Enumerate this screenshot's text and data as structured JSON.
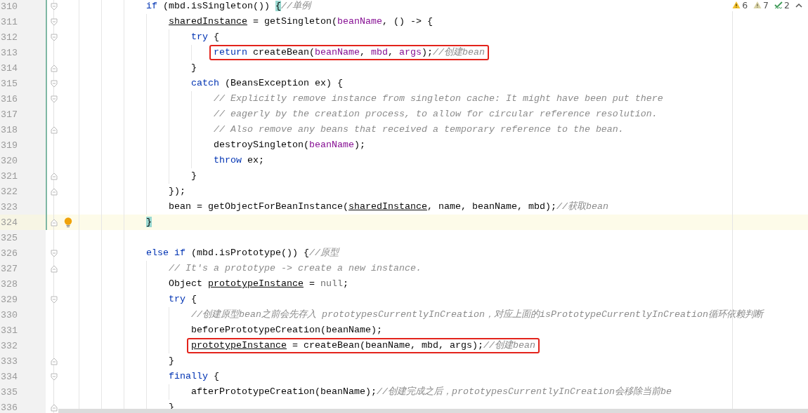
{
  "inspections": [
    {
      "kind": "warning",
      "count": "6"
    },
    {
      "kind": "weak-warning",
      "count": "7"
    },
    {
      "kind": "typo",
      "count": "2"
    }
  ],
  "lines": [
    {
      "number": "310",
      "fold_open": true,
      "changed": true,
      "tokens": [
        {
          "text": "if",
          "kind": "keyword"
        },
        {
          "text": " (mbd.isSingleton()) ",
          "kind": "plain"
        },
        {
          "text": "{",
          "kind": "brace-match"
        },
        {
          "text": "//单例",
          "kind": "comment"
        }
      ],
      "children": [
        {
          "number": "311",
          "fold_open": true,
          "changed": true,
          "tokens": [
            {
              "text": "sharedInstance",
              "kind": "field"
            },
            {
              "text": " = getSingleton(",
              "kind": "plain"
            },
            {
              "text": "beanName",
              "kind": "param"
            },
            {
              "text": ", () -> {",
              "kind": "plain"
            }
          ],
          "children": [
            {
              "number": "312",
              "fold_open": true,
              "changed": true,
              "tokens": [
                {
                  "text": "try",
                  "kind": "keyword"
                },
                {
                  "text": " {",
                  "kind": "plain"
                }
              ],
              "children": [
                {
                  "number": "313",
                  "changed": true,
                  "boxed": true,
                  "tokens": [
                    {
                      "text": "return",
                      "kind": "keyword"
                    },
                    {
                      "text": " createBean(",
                      "kind": "plain"
                    },
                    {
                      "text": "beanName",
                      "kind": "param"
                    },
                    {
                      "text": ", ",
                      "kind": "plain"
                    },
                    {
                      "text": "mbd",
                      "kind": "param"
                    },
                    {
                      "text": ", ",
                      "kind": "plain"
                    },
                    {
                      "text": "args",
                      "kind": "param"
                    },
                    {
                      "text": ");",
                      "kind": "plain"
                    },
                    {
                      "text": "//创建bean",
                      "kind": "comment"
                    }
                  ]
                }
              ]
            },
            {
              "number": "314",
              "fold_close": true,
              "changed": true,
              "tokens": [
                {
                  "text": "}",
                  "kind": "plain"
                }
              ]
            },
            {
              "number": "315",
              "fold_open": true,
              "changed": true,
              "tokens": [
                {
                  "text": "catch",
                  "kind": "keyword"
                },
                {
                  "text": " (BeansException ex) {",
                  "kind": "plain"
                }
              ],
              "children": [
                {
                  "number": "316",
                  "fold_open": true,
                  "changed": true,
                  "tokens": [
                    {
                      "text": "// Explicitly remove instance from singleton cache: It might have been put there",
                      "kind": "comment"
                    }
                  ]
                },
                {
                  "number": "317",
                  "changed": true,
                  "tokens": [
                    {
                      "text": "// eagerly by the creation process, to allow for circular reference resolution.",
                      "kind": "comment"
                    }
                  ]
                },
                {
                  "number": "318",
                  "fold_close": true,
                  "changed": true,
                  "tokens": [
                    {
                      "text": "// Also remove any beans that received a temporary reference to the bean.",
                      "kind": "comment"
                    }
                  ]
                },
                {
                  "number": "319",
                  "changed": true,
                  "tokens": [
                    {
                      "text": "destroySingleton(",
                      "kind": "plain"
                    },
                    {
                      "text": "beanName",
                      "kind": "param"
                    },
                    {
                      "text": ");",
                      "kind": "plain"
                    }
                  ]
                },
                {
                  "number": "320",
                  "changed": true,
                  "tokens": [
                    {
                      "text": "throw",
                      "kind": "keyword"
                    },
                    {
                      "text": " ex;",
                      "kind": "plain"
                    }
                  ]
                }
              ]
            },
            {
              "number": "321",
              "fold_close": true,
              "changed": true,
              "tokens": [
                {
                  "text": "}",
                  "kind": "plain"
                }
              ]
            }
          ]
        },
        {
          "number": "322",
          "fold_close": true,
          "changed": true,
          "tokens": [
            {
              "text": "});",
              "kind": "plain"
            }
          ]
        },
        {
          "number": "323",
          "changed": true,
          "tokens": [
            {
              "text": "bean = getObjectForBeanInstance(",
              "kind": "plain"
            },
            {
              "text": "sharedInstance",
              "kind": "field"
            },
            {
              "text": ", name, beanName, mbd);",
              "kind": "plain"
            },
            {
              "text": "//获取bean",
              "kind": "comment"
            }
          ]
        }
      ]
    },
    {
      "number": "324",
      "fold_close": true,
      "changed": true,
      "current": true,
      "bulb": true,
      "tokens": [
        {
          "text": "}",
          "kind": "brace-match"
        }
      ]
    },
    {
      "number": "325"
    },
    {
      "number": "326",
      "fold_open": true,
      "tokens": [
        {
          "text": "else if",
          "kind": "keyword"
        },
        {
          "text": " (mbd.isPrototype()) {",
          "kind": "plain"
        },
        {
          "text": "//原型",
          "kind": "comment"
        }
      ],
      "children": [
        {
          "number": "327",
          "fold_close": true,
          "tokens": [
            {
              "text": "// It's a prototype -> create a new instance.",
              "kind": "comment"
            }
          ]
        },
        {
          "number": "328",
          "tokens": [
            {
              "text": "Object ",
              "kind": "plain"
            },
            {
              "text": "prototypeInstance",
              "kind": "field"
            },
            {
              "text": " = ",
              "kind": "plain"
            },
            {
              "text": "null",
              "kind": "literal"
            },
            {
              "text": ";",
              "kind": "plain"
            }
          ]
        },
        {
          "number": "329",
          "fold_open": true,
          "tokens": [
            {
              "text": "try",
              "kind": "keyword"
            },
            {
              "text": " {",
              "kind": "plain"
            }
          ],
          "children": [
            {
              "number": "330",
              "tokens": [
                {
                  "text": "//创建原型bean之前会先存入 prototypesCurrentlyInCreation，对应上面的isPrototypeCurrentlyInCreation循环依赖判断",
                  "kind": "comment"
                }
              ]
            },
            {
              "number": "331",
              "tokens": [
                {
                  "text": "beforePrototypeCreation(beanName);",
                  "kind": "plain"
                }
              ]
            },
            {
              "number": "332",
              "boxed": true,
              "tokens": [
                {
                  "text": "prototypeInstance",
                  "kind": "field"
                },
                {
                  "text": " = createBean(beanName, mbd, args);",
                  "kind": "plain"
                },
                {
                  "text": "//创建bean",
                  "kind": "comment"
                }
              ]
            }
          ]
        },
        {
          "number": "333",
          "fold_close": true,
          "tokens": [
            {
              "text": "}",
              "kind": "plain"
            }
          ]
        },
        {
          "number": "334",
          "fold_open": true,
          "tokens": [
            {
              "text": "finally",
              "kind": "keyword"
            },
            {
              "text": " {",
              "kind": "plain"
            }
          ],
          "children": [
            {
              "number": "335",
              "tokens": [
                {
                  "text": "afterPrototypeCreation(beanName);",
                  "kind": "plain"
                },
                {
                  "text": "//创建完成之后，prototypesCurrentlyInCreation会移除当前be",
                  "kind": "comment"
                }
              ]
            }
          ]
        },
        {
          "number": "336",
          "fold_close": true,
          "tokens": [
            {
              "text": "}",
              "kind": "plain"
            }
          ]
        }
      ]
    }
  ]
}
